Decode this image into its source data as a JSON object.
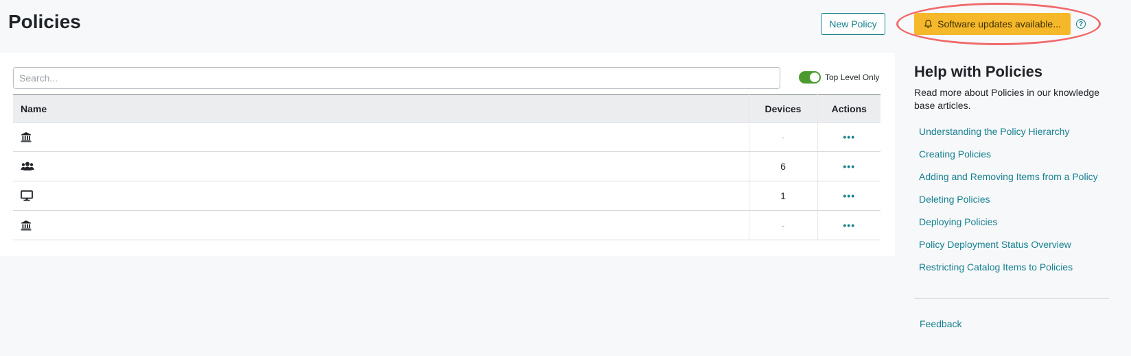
{
  "header": {
    "title": "Policies",
    "new_policy_label": "New Policy",
    "update_label": "Software updates available...",
    "help_icon": "?"
  },
  "search": {
    "placeholder": "Search...",
    "value": ""
  },
  "toggle": {
    "label": "Top Level Only",
    "checked": true
  },
  "table": {
    "columns": {
      "name": "Name",
      "devices": "Devices",
      "actions": "Actions"
    },
    "rows": [
      {
        "icon": "institution-icon",
        "name": "",
        "devices": "-",
        "actions": "•••"
      },
      {
        "icon": "users-icon",
        "name": "",
        "devices": "6",
        "actions": "•••"
      },
      {
        "icon": "desktop-icon",
        "name": "",
        "devices": "1",
        "actions": "•••"
      },
      {
        "icon": "institution-icon",
        "name": "",
        "devices": "-",
        "actions": "•••"
      }
    ]
  },
  "help": {
    "title": "Help with Policies",
    "description": "Read more about Policies in our knowledge base articles.",
    "links": [
      "Understanding the Policy Hierarchy",
      "Creating Policies",
      "Adding and Removing Items from a Policy",
      "Deleting Policies",
      "Deploying Policies",
      "Policy Deployment Status Overview",
      "Restricting Catalog Items to Policies"
    ],
    "feedback": "Feedback"
  },
  "colors": {
    "accent": "#16808f",
    "warning": "#f5b82a",
    "toggle_on": "#4b9a2e",
    "highlight": "#f0696b"
  }
}
